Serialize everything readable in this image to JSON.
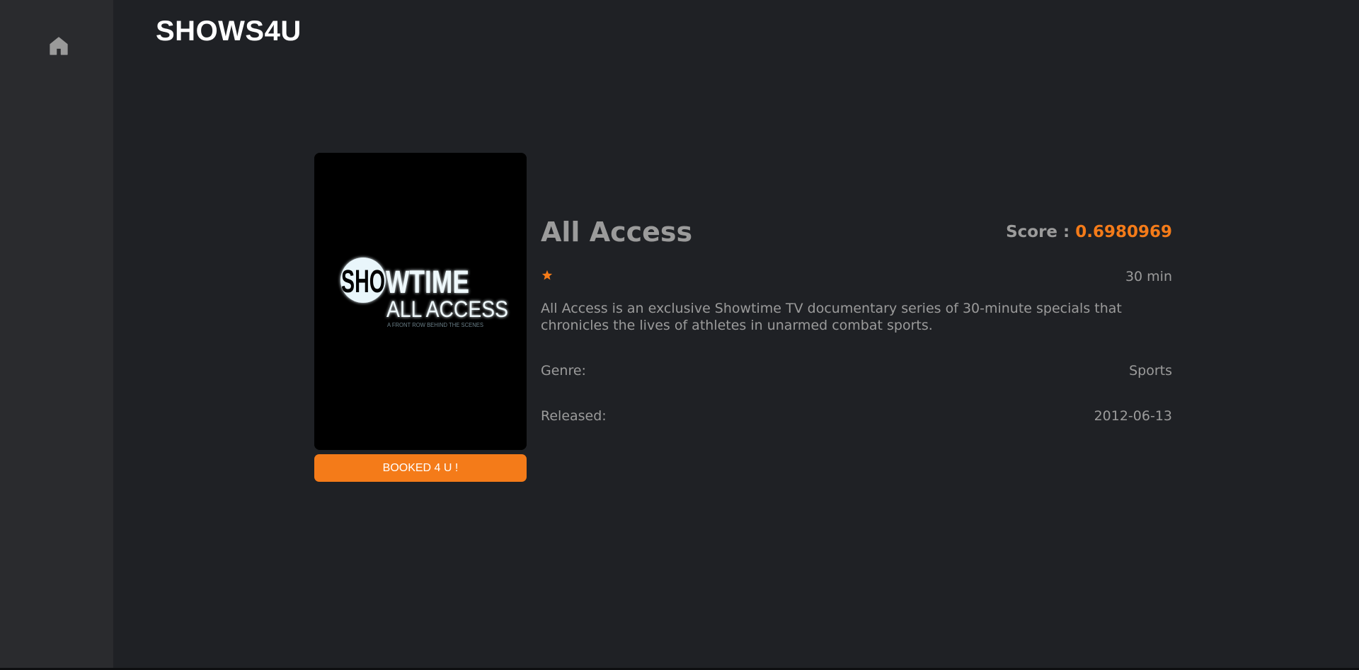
{
  "app": {
    "name": "SHOWS4U"
  },
  "sidebar": {
    "home_icon": "home-icon"
  },
  "show": {
    "title": "All Access",
    "score_label": "Score : ",
    "score_value": "0.6980969",
    "rating_stars": 1,
    "runtime": "30 min",
    "description": "All Access is an exclusive Showtime TV documentary series of 30-minute specials that chronicles the lives of athletes in unarmed combat sports.",
    "genre_label": "Genre:",
    "genre_value": "Sports",
    "released_label": "Released:",
    "released_value": "2012-06-13",
    "poster": {
      "logo_text": "SHOWTIME",
      "logo_text_o_part": "SHO",
      "logo_text_rest": "WTIME",
      "subtitle": "ALL ACCESS",
      "tagline": "A FRONT ROW BEHIND THE SCENES"
    },
    "book_button": "BOOKED 4 U !"
  },
  "colors": {
    "background": "#1f2125",
    "sidebar": "#2a2b2e",
    "accent": "#f47b19",
    "text_muted": "#9b9b9b",
    "text_white": "#ffffff"
  }
}
